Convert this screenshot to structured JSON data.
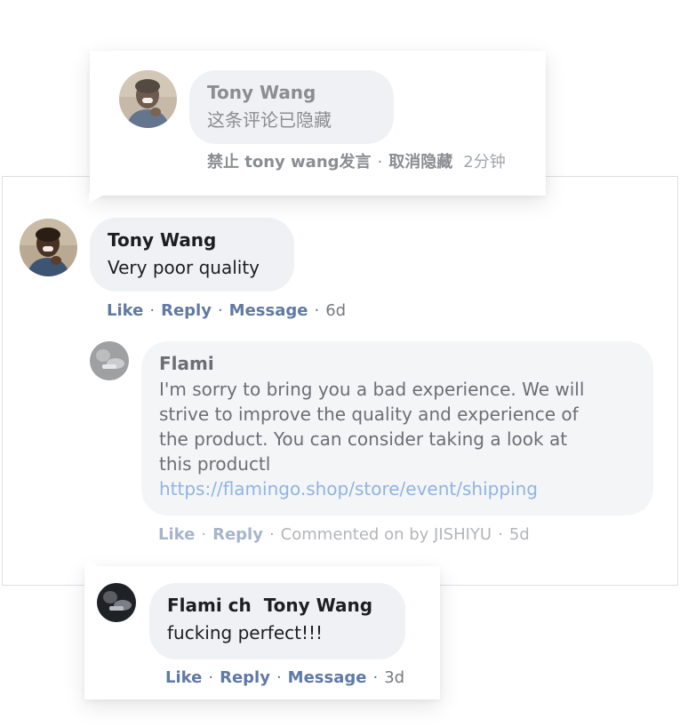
{
  "hidden_comment": {
    "author": "Tony Wang",
    "text": "这条评论已隐藏",
    "ban_label": "禁止 tony wang发言",
    "unhide_label": "取消隐藏",
    "time": "2分钟"
  },
  "main_comment": {
    "author": "Tony Wang",
    "text": "Very poor quality",
    "like": "Like",
    "reply": "Reply",
    "message": "Message",
    "time": "6d"
  },
  "reply_comment": {
    "author": "Flami",
    "lines": [
      "I'm sorry to bring you a bad experience. We will",
      "strive to improve the quality and experience of",
      "the product. You can consider taking a look at",
      "this productl"
    ],
    "link": "https://flamingo.shop/store/event/shipping",
    "like": "Like",
    "reply": "Reply",
    "commented_on": "Commented on by JISHIYU",
    "time": "5d"
  },
  "bottom_comment": {
    "author": "Flami ch  Tony Wang",
    "text": "fucking perfect!!!",
    "like": "Like",
    "reply": "Reply",
    "message": "Message",
    "time": "3d"
  }
}
